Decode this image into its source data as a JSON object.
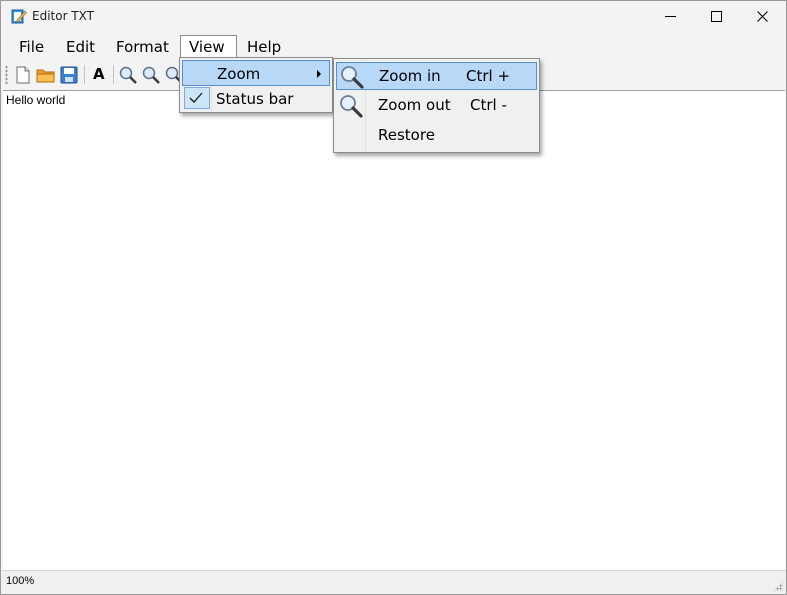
{
  "window": {
    "title": "Editor TXT"
  },
  "menubar": {
    "items": [
      {
        "label": "File"
      },
      {
        "label": "Edit"
      },
      {
        "label": "Format"
      },
      {
        "label": "View"
      },
      {
        "label": "Help"
      }
    ]
  },
  "toolbar": {
    "buttons": [
      {
        "icon": "new-file-icon"
      },
      {
        "icon": "open-folder-icon"
      },
      {
        "icon": "save-icon"
      },
      {
        "icon": "font-icon",
        "label": "A"
      },
      {
        "icon": "zoom-in-icon"
      },
      {
        "icon": "zoom-out-icon"
      },
      {
        "icon": "zoom-restore-icon"
      }
    ]
  },
  "editor": {
    "text": "Hello world"
  },
  "statusbar": {
    "zoom": "100%"
  },
  "view_menu": {
    "items": [
      {
        "label": "Zoom",
        "has_submenu": true,
        "highlighted": true
      },
      {
        "label": "Status bar",
        "checked": true
      }
    ]
  },
  "zoom_menu": {
    "items": [
      {
        "label": "Zoom in",
        "shortcut": "Ctrl +",
        "icon": "magnifier-icon",
        "highlighted": true
      },
      {
        "label": "Zoom out",
        "shortcut": "Ctrl -",
        "icon": "magnifier-icon"
      },
      {
        "label": "Restore",
        "shortcut": ""
      }
    ]
  },
  "colors": {
    "highlight": "#b8d8f8",
    "highlight_border": "#5a8fcb",
    "chrome": "#f3f3f3"
  }
}
